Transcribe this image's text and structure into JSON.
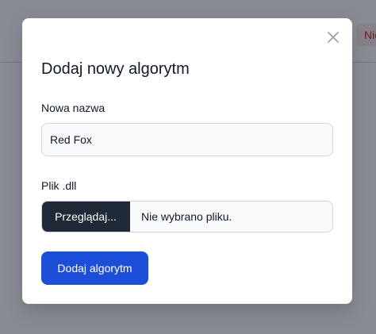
{
  "background": {
    "badge_label": "Nie"
  },
  "modal": {
    "title": "Dodaj nowy algorytm",
    "close_icon": "close-icon",
    "name_field": {
      "label": "Nowa nazwa",
      "value": "Red Fox"
    },
    "file_field": {
      "label": "Plik .dll",
      "browse_label": "Przeglądaj...",
      "status": "Nie wybrano pliku."
    },
    "submit_label": "Dodaj algorytm"
  },
  "colors": {
    "primary": "#1d4ed8",
    "file_button": "#1f2937",
    "badge_text": "#c81e1e",
    "overlay": "#111827"
  }
}
